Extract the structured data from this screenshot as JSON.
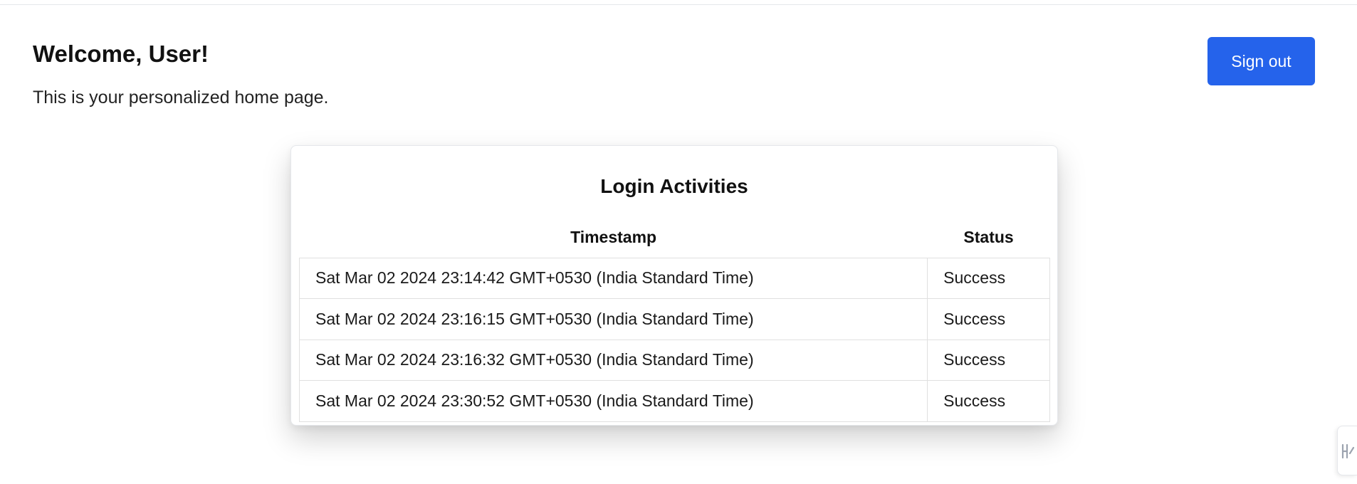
{
  "header": {
    "title": "Welcome, User!",
    "subtitle": "This is your personalized home page."
  },
  "actions": {
    "signout_label": "Sign out"
  },
  "login_activities": {
    "title": "Login Activities",
    "columns": [
      "Timestamp",
      "Status"
    ],
    "rows": [
      {
        "timestamp": "Sat Mar 02 2024 23:14:42 GMT+0530 (India Standard Time)",
        "status": "Success"
      },
      {
        "timestamp": "Sat Mar 02 2024 23:16:15 GMT+0530 (India Standard Time)",
        "status": "Success"
      },
      {
        "timestamp": "Sat Mar 02 2024 23:16:32 GMT+0530 (India Standard Time)",
        "status": "Success"
      },
      {
        "timestamp": "Sat Mar 02 2024 23:30:52 GMT+0530 (India Standard Time)",
        "status": "Success"
      }
    ]
  },
  "side_widget": {
    "icon": "extension-icon"
  },
  "colors": {
    "accent": "#2563eb",
    "border": "#e0e0e0"
  }
}
